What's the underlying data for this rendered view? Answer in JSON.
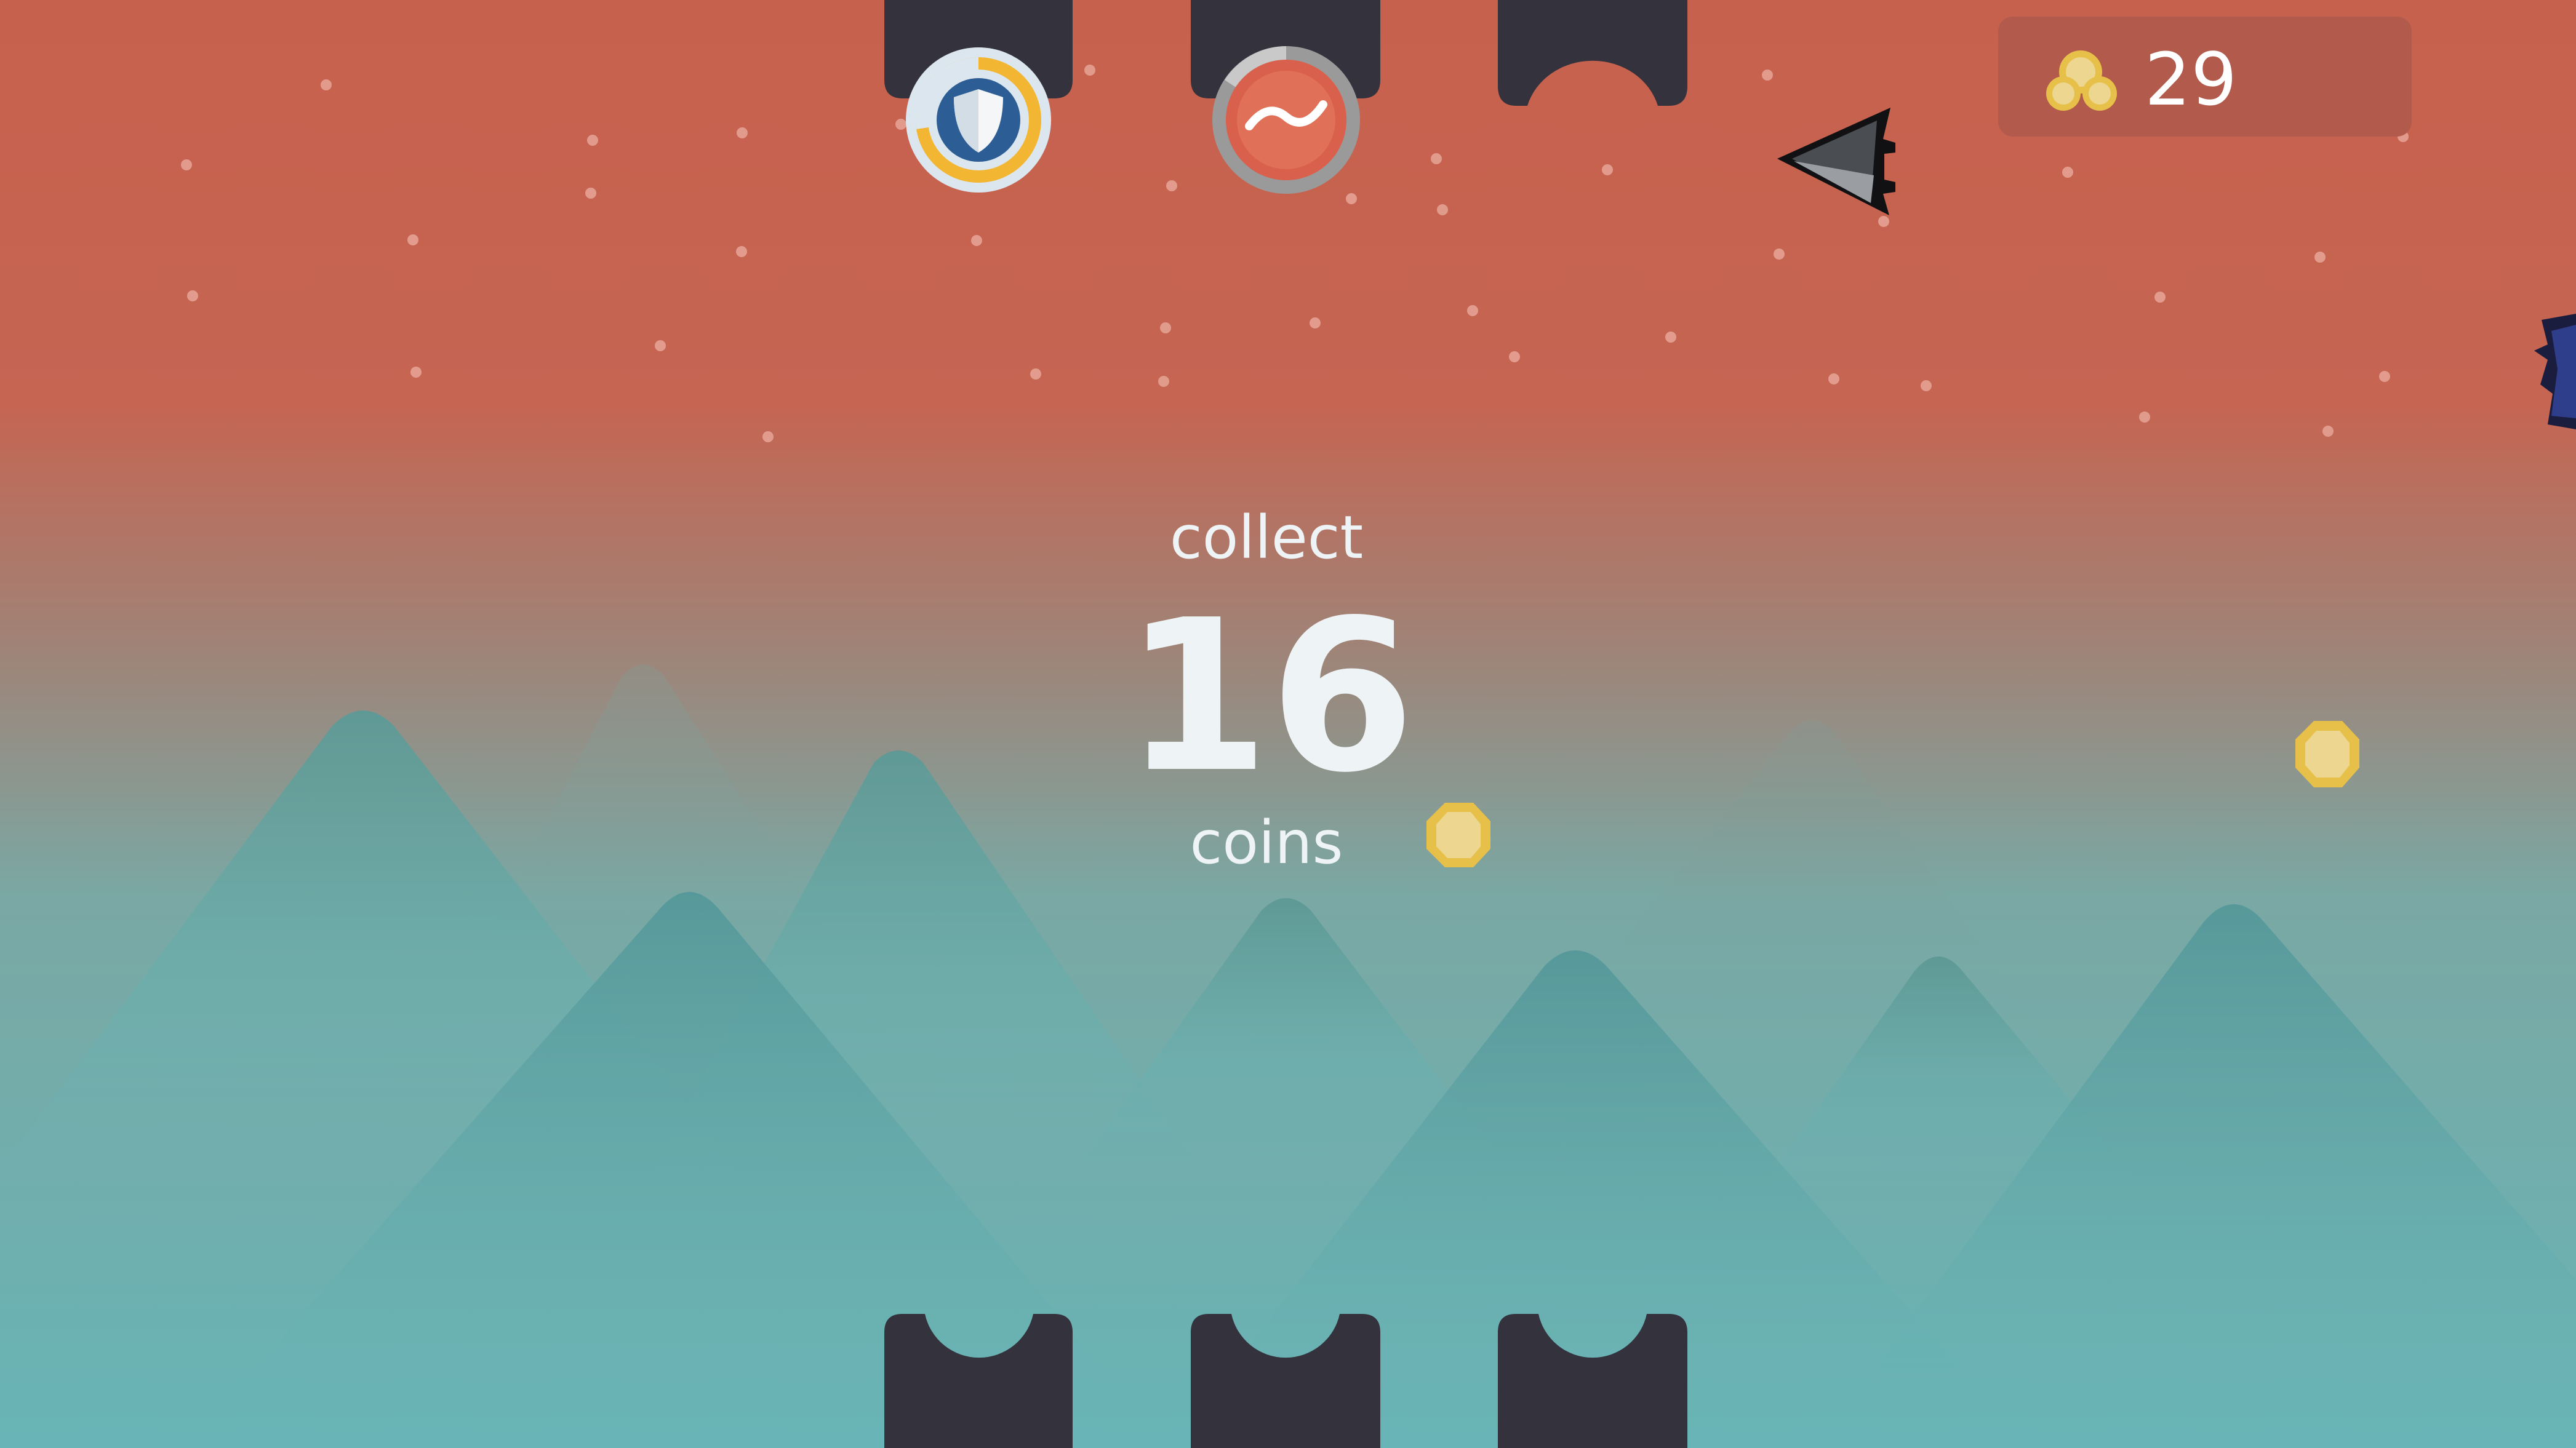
{
  "hud": {
    "coin_count": "29",
    "coin_icon": "coin-stack-icon"
  },
  "objective": {
    "line1": "collect",
    "count": "16",
    "line2": "coins"
  },
  "powerups": [
    {
      "name": "shield-powerup",
      "icon": "shield-icon",
      "ring_color": "#f2b632",
      "fill": 0.8
    },
    {
      "name": "wave-powerup",
      "icon": "wave-icon",
      "ring_color": "#9a9a9a",
      "fill": 0.85
    },
    {
      "name": "empty-slot",
      "icon": "",
      "ring_color": "",
      "fill": 0
    }
  ],
  "colors": {
    "sky_top": "#c6614d",
    "sky_bottom": "#68b4b6",
    "slot": "#33323d",
    "coin": "#e7c04a",
    "hud_panel": "#b25a4b",
    "player": "#44474c",
    "enemy": "#2f3e8a"
  }
}
